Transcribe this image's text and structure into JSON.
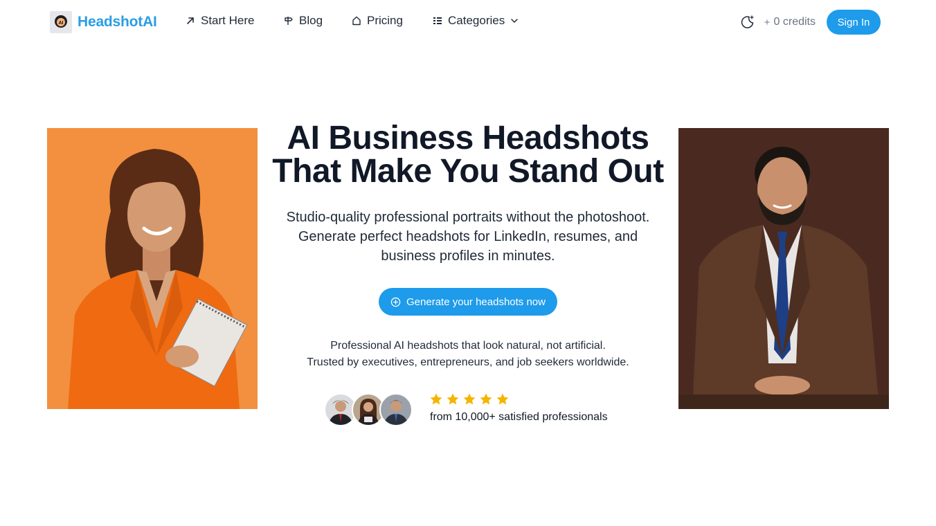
{
  "nav": {
    "logo_badge": "AI",
    "brand": "HeadshotAI",
    "links": [
      {
        "label": "Start Here",
        "icon": "arrow-up-right-icon"
      },
      {
        "label": "Blog",
        "icon": "signpost-icon"
      },
      {
        "label": "Pricing",
        "icon": "house-tag-icon"
      },
      {
        "label": "Categories",
        "icon": "list-icon"
      }
    ],
    "credits": "0 credits",
    "signin": "Sign In"
  },
  "hero": {
    "title_line1": "AI Business Headshots",
    "title_line2": "That Make You Stand Out",
    "sub_line1": "Studio-quality professional portraits without the photoshoot.",
    "sub_line2": "Generate perfect headshots for LinkedIn, resumes, and",
    "sub_line3": "business profiles in minutes.",
    "cta": "Generate your headshots now",
    "trust_line1": "Professional AI headshots that look natural, not artificial.",
    "trust_line2": "Trusted by executives, entrepreneurs, and job seekers worldwide.",
    "rating_stars": 5,
    "rating_text": "from 10,000+ satisfied professionals"
  },
  "colors": {
    "brand": "#2a9de6",
    "button": "#1e9bea",
    "star": "#f5b400",
    "left_bg": "#f08a3a",
    "right_bg": "#4a2a20"
  }
}
